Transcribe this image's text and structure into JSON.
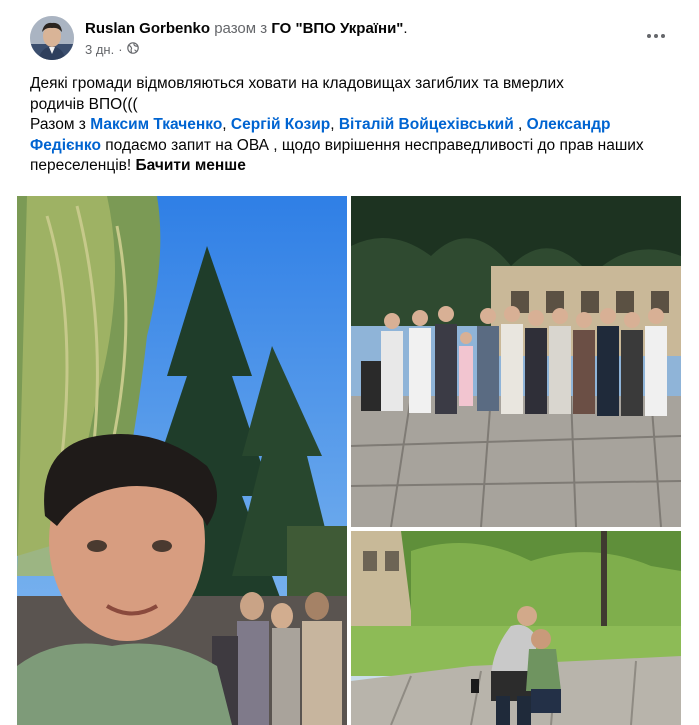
{
  "author": {
    "name": "Ruslan Gorbenko",
    "with_word": "разом з",
    "group": "ГО \"ВПО України\"",
    "period": "."
  },
  "meta": {
    "time": "3 дн.",
    "separator": "·",
    "audience_icon": "globe-icon"
  },
  "menu": {
    "icon": "more-horizontal-icon"
  },
  "post": {
    "line1": "Деякі громади відмовляються ховати на кладовищах загиблих та вмерлих",
    "line2": "родичів ВПО(((",
    "with_prefix": "Разом з",
    "tags": [
      "Максим Ткаченко",
      "Сергій Козир",
      "Віталій Войцехівський",
      "Олександр Федієнко"
    ],
    "sep1": ",",
    "sep2": ",",
    "sep3": " ,",
    "body": "подаємо запит на ОВА , щодо вирішення несправедливості до прав наших переселенців!",
    "see_less": "Бачити менше"
  },
  "colors": {
    "link": "#0064d1",
    "muted": "#65676b",
    "text": "#050505"
  }
}
